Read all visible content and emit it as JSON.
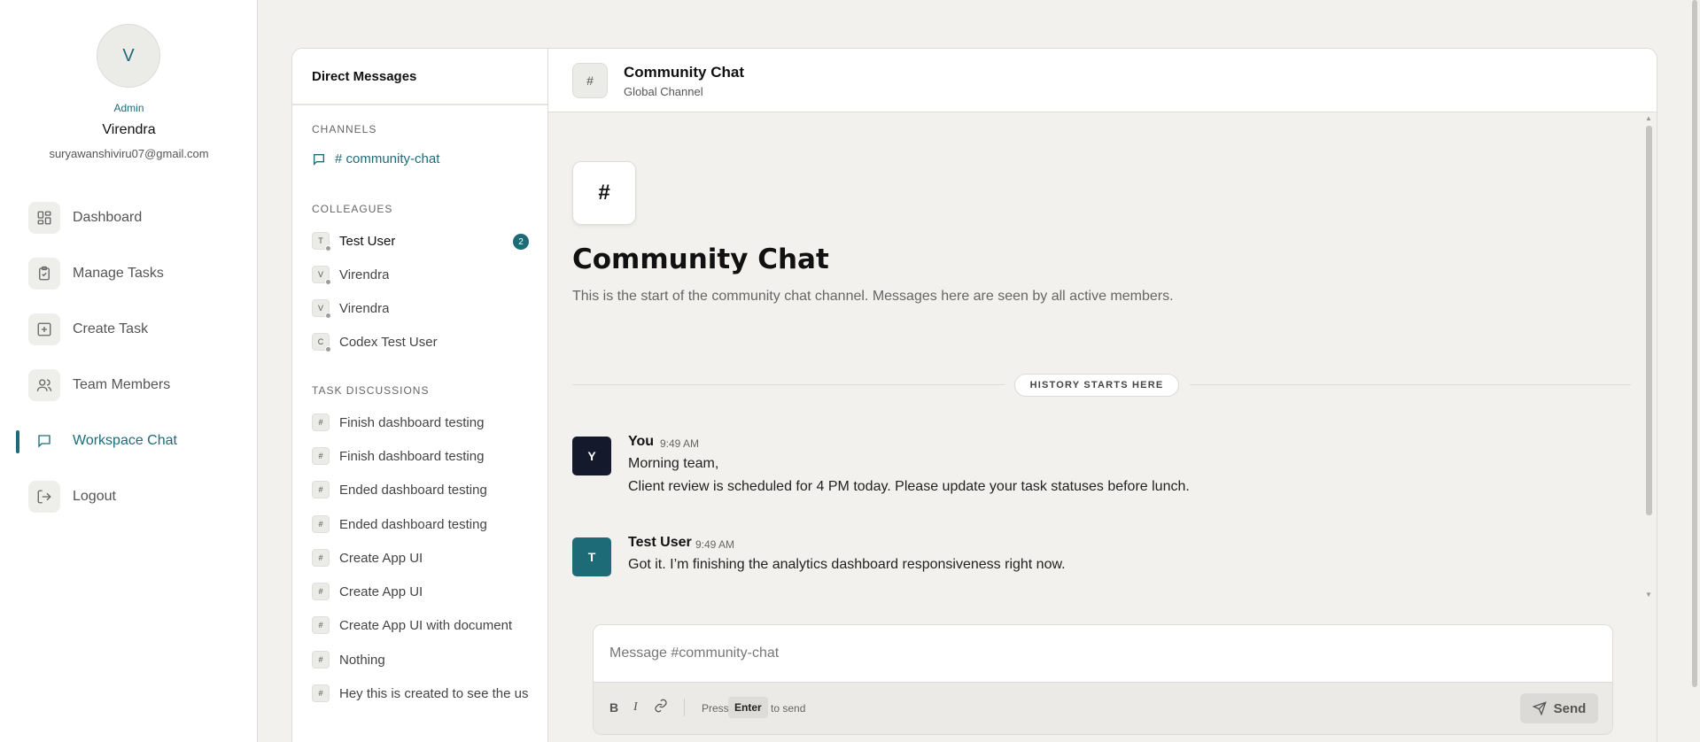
{
  "user": {
    "avatar_letter": "V",
    "role": "Admin",
    "name": "Virendra",
    "email": "suryawanshiviru07@gmail.com"
  },
  "nav": [
    {
      "label": "Dashboard",
      "icon": "grid-icon"
    },
    {
      "label": "Manage Tasks",
      "icon": "clipboard-check-icon"
    },
    {
      "label": "Create Task",
      "icon": "plus-square-icon"
    },
    {
      "label": "Team Members",
      "icon": "users-icon"
    },
    {
      "label": "Workspace Chat",
      "icon": "message-icon",
      "active": true
    },
    {
      "label": "Logout",
      "icon": "logout-icon"
    }
  ],
  "dm": {
    "header": "Direct Messages",
    "channels_title": "CHANNELS",
    "channel": "# community-chat",
    "colleagues_title": "COLLEAGUES",
    "colleagues": [
      {
        "initial": "T",
        "name": "Test User",
        "unread": "2"
      },
      {
        "initial": "V",
        "name": "Virendra"
      },
      {
        "initial": "V",
        "name": "Virendra"
      },
      {
        "initial": "C",
        "name": "Codex Test User"
      }
    ],
    "tasks_title": "TASK DISCUSSIONS",
    "tasks": [
      {
        "symbol": "#",
        "name": "Finish dashboard testing"
      },
      {
        "symbol": "#",
        "name": "Finish dashboard testing"
      },
      {
        "symbol": "#",
        "name": "Ended dashboard testing"
      },
      {
        "symbol": "#",
        "name": "Ended dashboard testing"
      },
      {
        "symbol": "#",
        "name": "Create App UI"
      },
      {
        "symbol": "#",
        "name": "Create App UI"
      },
      {
        "symbol": "#",
        "name": "Create App UI with document"
      },
      {
        "symbol": "#",
        "name": "Nothing"
      },
      {
        "symbol": "#",
        "name": "Hey this is created to see the us"
      }
    ]
  },
  "chat": {
    "header_symbol": "#",
    "title": "Community Chat",
    "subtitle": "Global Channel",
    "intro_symbol": "#",
    "intro_title": "Community Chat",
    "intro_desc": "This is the start of the community chat channel. Messages here are seen by all active members.",
    "history_label": "HISTORY STARTS HERE",
    "messages": [
      {
        "initial": "Y",
        "author": "You",
        "time": "9:49 AM",
        "avatar_color": "#141a2b",
        "lines": [
          "Morning team,",
          "Client review is scheduled for 4 PM today. Please update your task statuses before lunch."
        ]
      },
      {
        "initial": "T",
        "author": "Test User",
        "time": "9:49 AM",
        "avatar_color": "#1e6b78",
        "lines": [
          "Got it. I’m finishing the analytics dashboard responsiveness right now."
        ]
      }
    ],
    "composer": {
      "placeholder": "Message #community-chat",
      "bold": "B",
      "italic": "I",
      "hint_press": "Press",
      "hint_key": "Enter",
      "hint_send": "to send",
      "send_label": "Send"
    }
  },
  "colors": {
    "accent": "#1e6b78",
    "background": "#f2f1ee"
  }
}
